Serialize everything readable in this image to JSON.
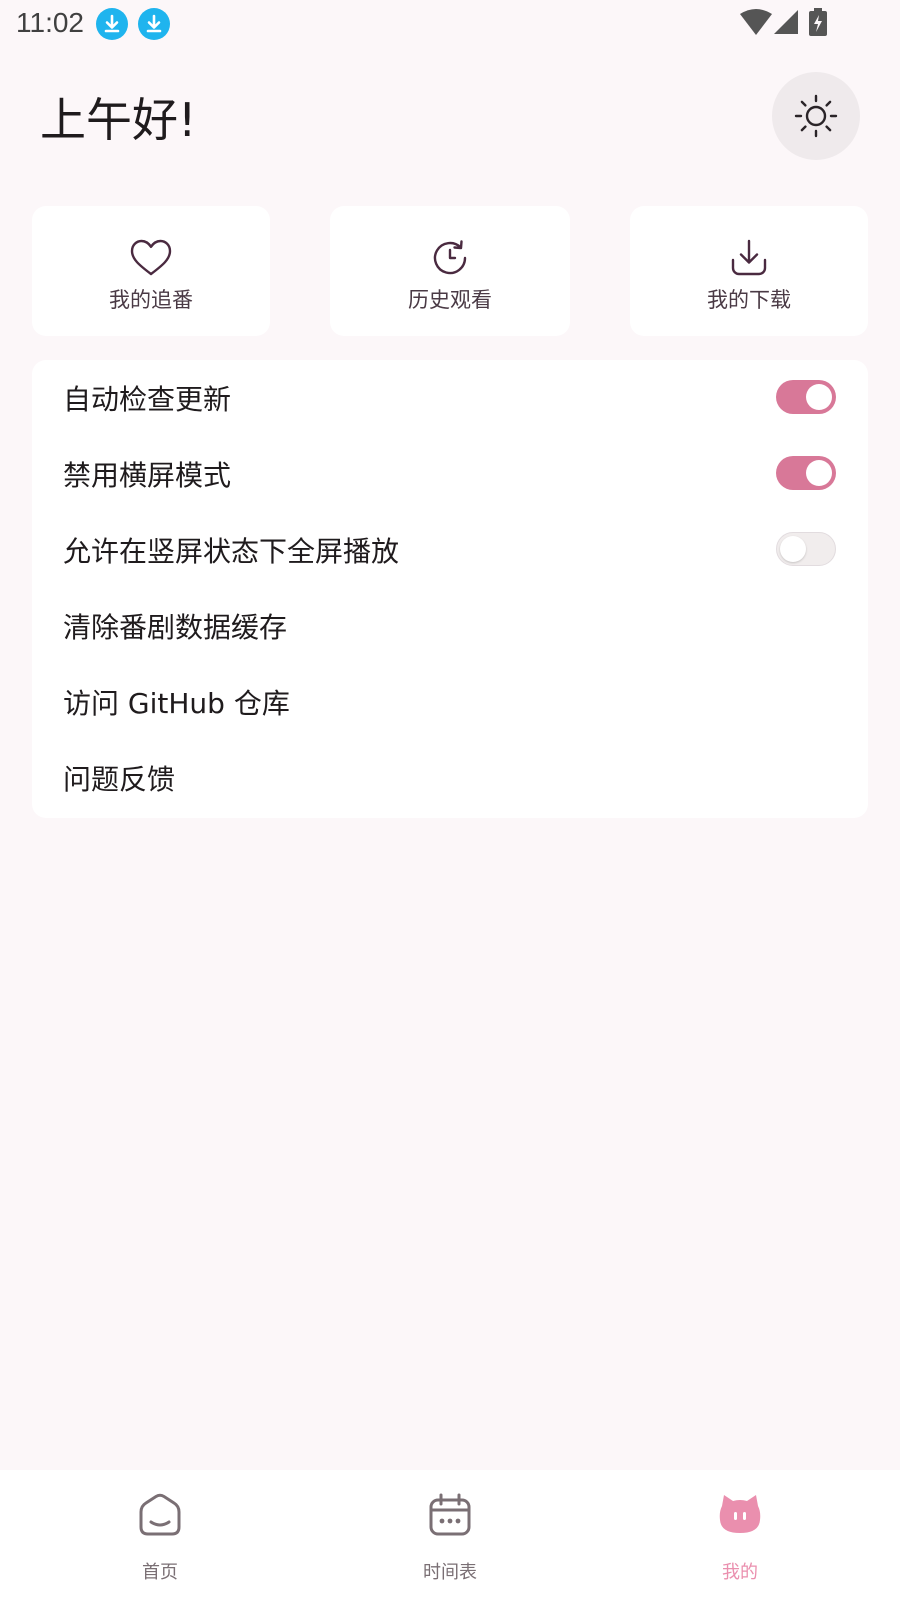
{
  "status_bar": {
    "time": "11:02",
    "icons": [
      "download-icon",
      "download-icon",
      "wifi-icon",
      "cellular-signal-icon",
      "battery-charging-icon"
    ]
  },
  "header": {
    "greeting": "上午好!",
    "theme_icon": "sun-icon"
  },
  "quick_actions": [
    {
      "label": "我的追番",
      "icon": "heart-icon"
    },
    {
      "label": "历史观看",
      "icon": "history-clock-icon"
    },
    {
      "label": "我的下载",
      "icon": "download-tray-icon"
    }
  ],
  "settings": {
    "auto_update": {
      "label": "自动检查更新",
      "enabled": true
    },
    "disable_landscape": {
      "label": "禁用横屏模式",
      "enabled": true
    },
    "fullscreen_portrait": {
      "label": "允许在竖屏状态下全屏播放",
      "enabled": false
    },
    "clear_cache": {
      "label": "清除番剧数据缓存"
    },
    "github": {
      "label": "访问 GitHub 仓库"
    },
    "feedback": {
      "label": "问题反馈"
    }
  },
  "bottom_nav": {
    "items": [
      {
        "label": "首页",
        "icon": "home-icon",
        "active": false
      },
      {
        "label": "时间表",
        "icon": "calendar-icon",
        "active": false
      },
      {
        "label": "我的",
        "icon": "cat-face-icon",
        "active": true
      }
    ]
  },
  "colors": {
    "accent": "#d87898",
    "nav_active": "#ea8fae",
    "background": "#fcf7f9"
  }
}
